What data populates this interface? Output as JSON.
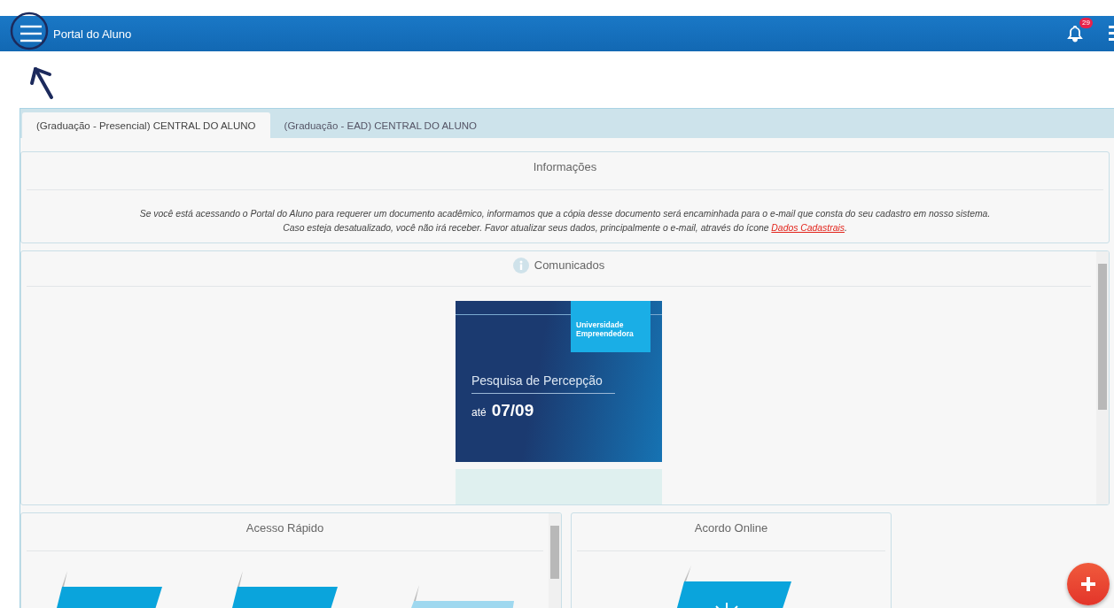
{
  "header": {
    "title": "Portal do Aluno",
    "notification_count": "29"
  },
  "tabs": [
    {
      "label": "(Graduação - Presencial) CENTRAL DO ALUNO",
      "selected": true
    },
    {
      "label": "(Graduação - EAD) CENTRAL DO ALUNO",
      "selected": false
    }
  ],
  "informacoes": {
    "title": "Informações",
    "line_1": "Se você está acessando o Portal do Aluno para requerer um documento acadêmico, informamos que a cópia desse documento será encaminhada para o e-mail que consta do seu cadastro em nosso sistema.",
    "line_2": "Caso esteja desatualizado, você não irá receber. Favor atualizar seus dados, principalmente o e-mail, através do ícone",
    "link": "Dados Cadastrais",
    "line_2_end": "."
  },
  "comunicados": {
    "title": "Comunicados",
    "banner": {
      "badge": "Universidade Empreendedora",
      "heading": "Pesquisa de Percepção",
      "date_prefix": "até",
      "date": "07/09"
    }
  },
  "acesso_rapido": {
    "title": "Acesso Rápido"
  },
  "acordo_online": {
    "title": "Acordo Online"
  }
}
